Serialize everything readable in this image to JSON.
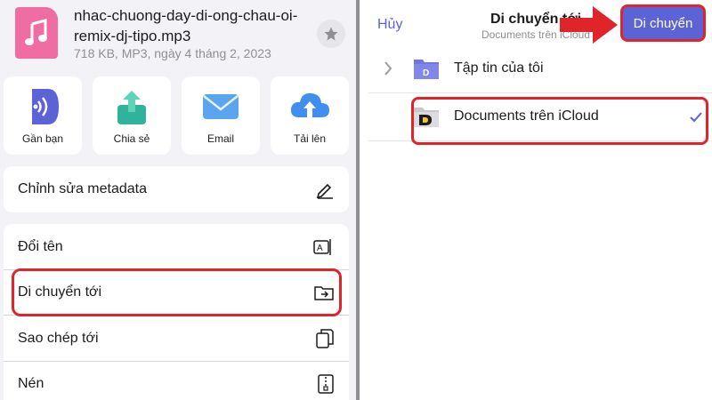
{
  "file": {
    "name": "nhac-chuong-day-di-ong-chau-oi-remix-dj-tipo.mp3",
    "meta": "718 KB, MP3, ngày 4 tháng 2, 2023",
    "thumb_color": "#ef6da2",
    "thumb_icon": "music-note-icon",
    "favorite_icon": "star-icon"
  },
  "actions": [
    {
      "label": "Gần bạn",
      "icon": "airdrop-icon"
    },
    {
      "label": "Chia sẻ",
      "icon": "share-icon"
    },
    {
      "label": "Email",
      "icon": "mail-icon"
    },
    {
      "label": "Tải lên",
      "icon": "cloud-upload-icon"
    }
  ],
  "menu": [
    {
      "label": "Chỉnh sửa metadata",
      "icon": "edit-icon"
    },
    {
      "label": "Đổi tên",
      "icon": "rename-icon"
    },
    {
      "label": "Di chuyển tới",
      "icon": "move-folder-icon"
    },
    {
      "label": "Sao chép tới",
      "icon": "copy-icon"
    },
    {
      "label": "Nén",
      "icon": "zip-icon"
    }
  ],
  "picker": {
    "cancel": "Hủy",
    "title": "Di chuyển tới",
    "subtitle": "Documents trên iCloud",
    "move": "Di chuyển",
    "folders": [
      {
        "label": "Tập tin của tôi",
        "icon": "folder-icon",
        "selected": false
      },
      {
        "label": "Documents trên iCloud",
        "icon": "documents-app-icon",
        "selected": true
      }
    ]
  },
  "colors": {
    "accent": "#5b63d6",
    "highlight": "#e0252a"
  }
}
